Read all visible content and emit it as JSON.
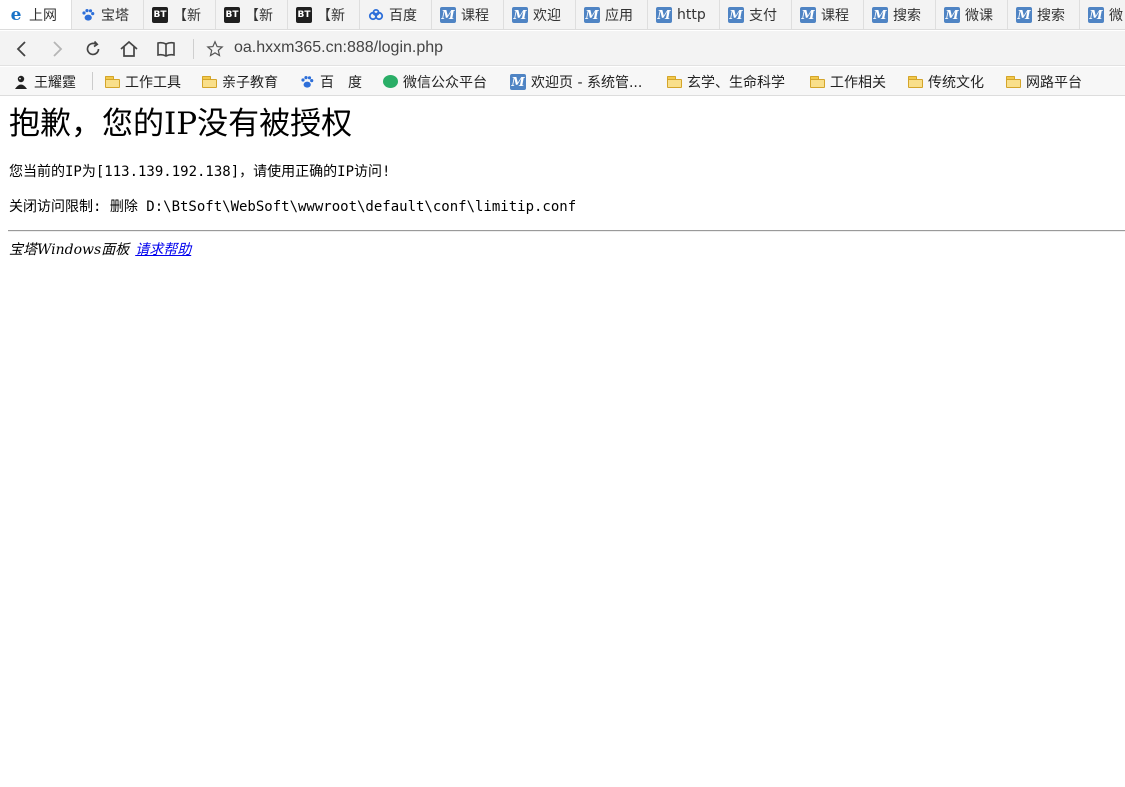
{
  "tabs": [
    {
      "label": "上网",
      "icon": "ie-icon"
    },
    {
      "label": "宝塔",
      "icon": "baidu-paw-icon"
    },
    {
      "label": "【新",
      "icon": "bt-icon"
    },
    {
      "label": "【新",
      "icon": "bt-icon"
    },
    {
      "label": "【新",
      "icon": "bt-icon"
    },
    {
      "label": "百度",
      "icon": "baidu-netdisk-icon"
    },
    {
      "label": "课程",
      "icon": "m-icon"
    },
    {
      "label": "欢迎",
      "icon": "m-icon"
    },
    {
      "label": "应用",
      "icon": "m-icon"
    },
    {
      "label": "http",
      "icon": "m-icon"
    },
    {
      "label": "支付",
      "icon": "m-icon"
    },
    {
      "label": "课程",
      "icon": "m-icon"
    },
    {
      "label": "搜索",
      "icon": "m-icon"
    },
    {
      "label": "微课",
      "icon": "m-icon"
    },
    {
      "label": "搜索",
      "icon": "m-icon"
    },
    {
      "label": "微",
      "icon": "m-icon"
    }
  ],
  "address_bar": {
    "url": "oa.hxxm365.cn:888/login.php"
  },
  "bookmarks": [
    {
      "label": "王耀霆",
      "icon": "profile-icon"
    },
    {
      "label": "工作工具",
      "icon": "folder-icon"
    },
    {
      "label": "亲子教育",
      "icon": "folder-icon"
    },
    {
      "label": "百　度",
      "icon": "baidu-paw-icon"
    },
    {
      "label": "微信公众平台",
      "icon": "wechat-icon"
    },
    {
      "label": "欢迎页 - 系统管...",
      "icon": "m-icon"
    },
    {
      "label": "玄学、生命科学",
      "icon": "folder-icon"
    },
    {
      "label": "工作相关",
      "icon": "folder-icon"
    },
    {
      "label": "传统文化",
      "icon": "folder-icon"
    },
    {
      "label": "网路平台",
      "icon": "folder-icon"
    }
  ],
  "page": {
    "title": "抱歉，您的IP没有被授权",
    "ip_message": "您当前的IP为[113.139.192.138]，请使用正确的IP访问!",
    "disable_message": "关闭访问限制: 删除 D:\\BtSoft\\WebSoft\\wwwroot\\default\\conf\\limitip.conf",
    "footer_text": "宝塔Windows面板",
    "help_link": "请求帮助"
  },
  "colors": {
    "tab_bar_bg": "#f3f3f3",
    "link": "#0000ee"
  }
}
